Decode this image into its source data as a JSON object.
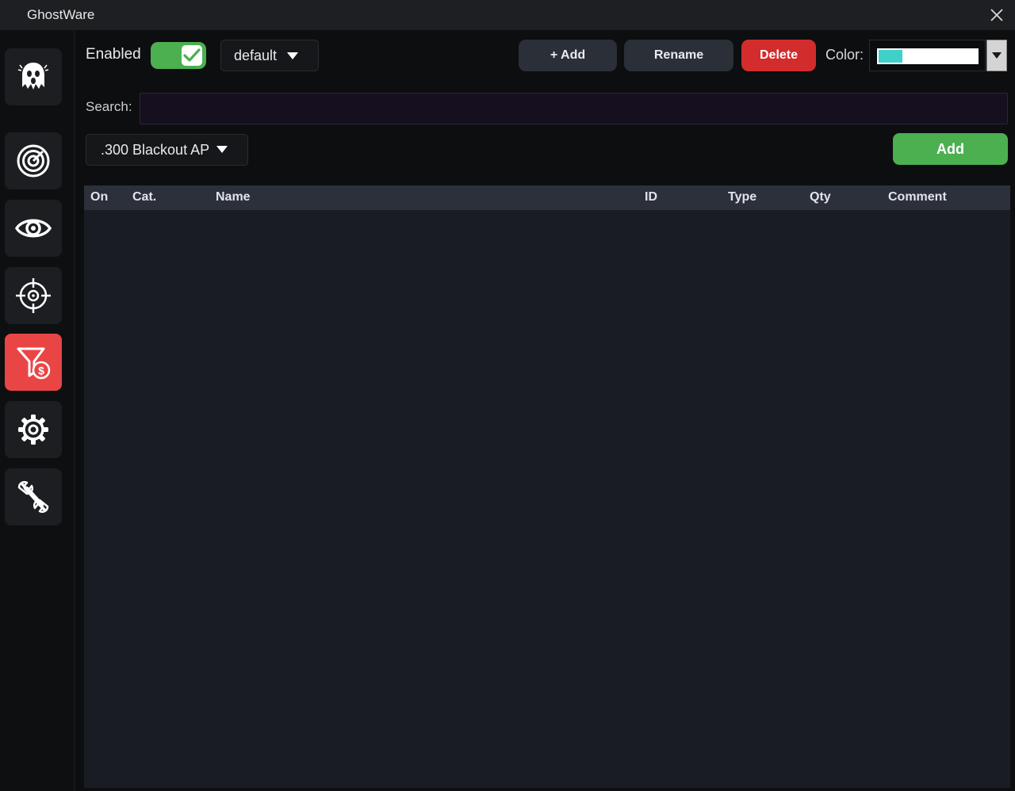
{
  "window": {
    "title": "GhostWare"
  },
  "sidebar": {
    "items": [
      {
        "icon": "ghost-logo-icon",
        "active": false
      },
      {
        "icon": "radar-icon",
        "active": false
      },
      {
        "icon": "eye-icon",
        "active": false
      },
      {
        "icon": "crosshair-icon",
        "active": false
      },
      {
        "icon": "loot-filter-icon",
        "active": true
      },
      {
        "icon": "gear-icon",
        "active": false
      },
      {
        "icon": "wrench-icon",
        "active": false
      }
    ],
    "active_color": "#ea4545"
  },
  "toolbar": {
    "enabled_label": "Enabled",
    "enabled": true,
    "profile_value": "default",
    "add_label": "+ Add",
    "rename_label": "Rename",
    "delete_label": "Delete",
    "color_label": "Color:",
    "color_value": "#3fd1c9"
  },
  "search": {
    "label": "Search:",
    "value": "",
    "placeholder": ""
  },
  "filter": {
    "item_value": ".300 Blackout AP",
    "add_label": "Add"
  },
  "table": {
    "columns": [
      "On",
      "Cat.",
      "Name",
      "ID",
      "Type",
      "Qty",
      "Comment"
    ],
    "rows": []
  }
}
